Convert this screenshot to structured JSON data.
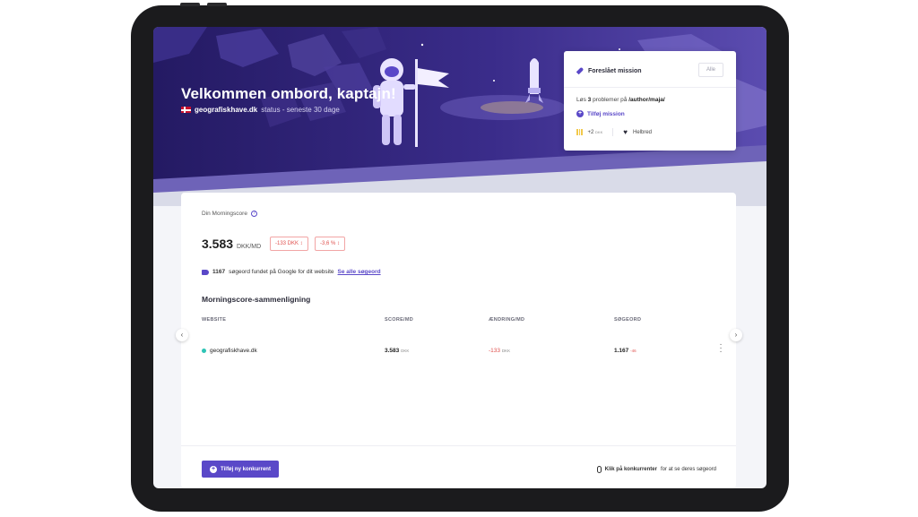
{
  "hero": {
    "title": "Velkommen ombord, kaptajn!",
    "site": "geografiskhave.dk",
    "status": "status - seneste 30 dage"
  },
  "mission": {
    "title": "Foreslået mission",
    "all_label": "Alle",
    "text_prefix": "Løs",
    "text_count": "3",
    "text_mid": "problemer på",
    "text_path": "/author/maja/",
    "add_label": "Tilføj mission",
    "reward": "+2",
    "reward_unit": "DKK",
    "health_label": "Helbred"
  },
  "score_card": {
    "label": "Din Morningscore",
    "value": "3.583",
    "unit": "DKK/MD",
    "change_abs": "-133 DKK",
    "change_pct": "-3,6 %",
    "keywords_count": "1167",
    "keywords_text": "søgeord fundet på Google for dit website",
    "keywords_link": "Se alle søgeord"
  },
  "comparison": {
    "title": "Morningscore-sammenligning",
    "columns": [
      "WEBSITE",
      "SCORE/MD",
      "ÆNDRING/MD",
      "SØGEORD"
    ],
    "rows": [
      {
        "website": "geografiskhave.dk",
        "score": "3.583",
        "score_unit": "DKK",
        "change": "-133",
        "change_unit": "DKK",
        "keywords": "1.167",
        "keywords_change": "-46"
      }
    ]
  },
  "footer": {
    "add_competitor": "Tilføj ny konkurrent",
    "hint_bold": "Klik på konkurrenter",
    "hint_rest": "for at se deres søgeord"
  },
  "colors": {
    "accent": "#5a48c8",
    "hero_dark": "#2a1f6e",
    "negative": "#e0524f",
    "site_dot": "#2ec4b6"
  }
}
